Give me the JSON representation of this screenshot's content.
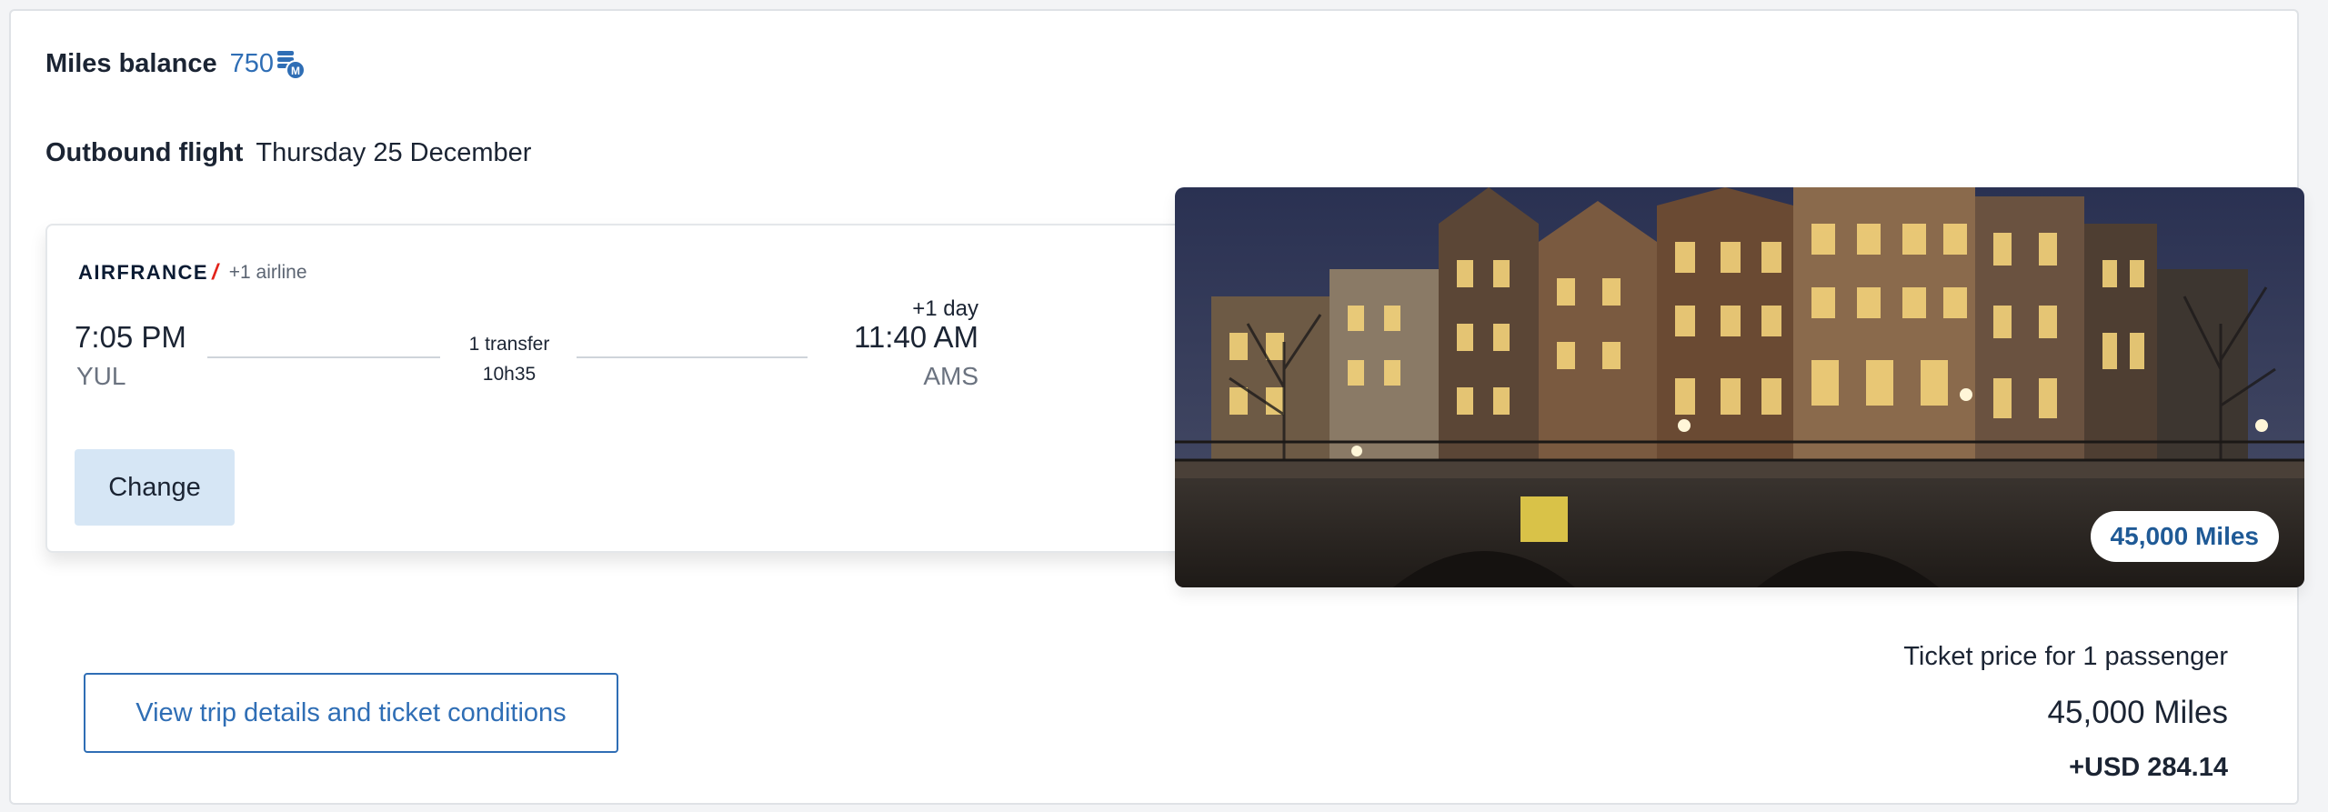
{
  "miles_balance": {
    "label": "Miles balance",
    "value": "750",
    "icon": "miles-coins-icon"
  },
  "outbound": {
    "label": "Outbound flight",
    "date": "Thursday 25 December"
  },
  "flight": {
    "airline_logo": "AIRFRANCE",
    "extra_airlines": "+1 airline",
    "departure_time": "7:05 PM",
    "departure_code": "YUL",
    "transfers": "1 transfer",
    "duration": "10h35",
    "day_offset": "+1 day",
    "arrival_time": "11:40 AM",
    "arrival_code": "AMS",
    "change_label": "Change"
  },
  "destination_image": {
    "badge": "45,000 Miles"
  },
  "details_button": "View trip details and ticket conditions",
  "price": {
    "label": "Ticket price for 1 passenger",
    "miles": "45,000 Miles",
    "usd": "+USD 284.14"
  },
  "colors": {
    "accent": "#2f6eb5",
    "change_bg": "#d6e6f5",
    "airline_red": "#e2231a"
  }
}
